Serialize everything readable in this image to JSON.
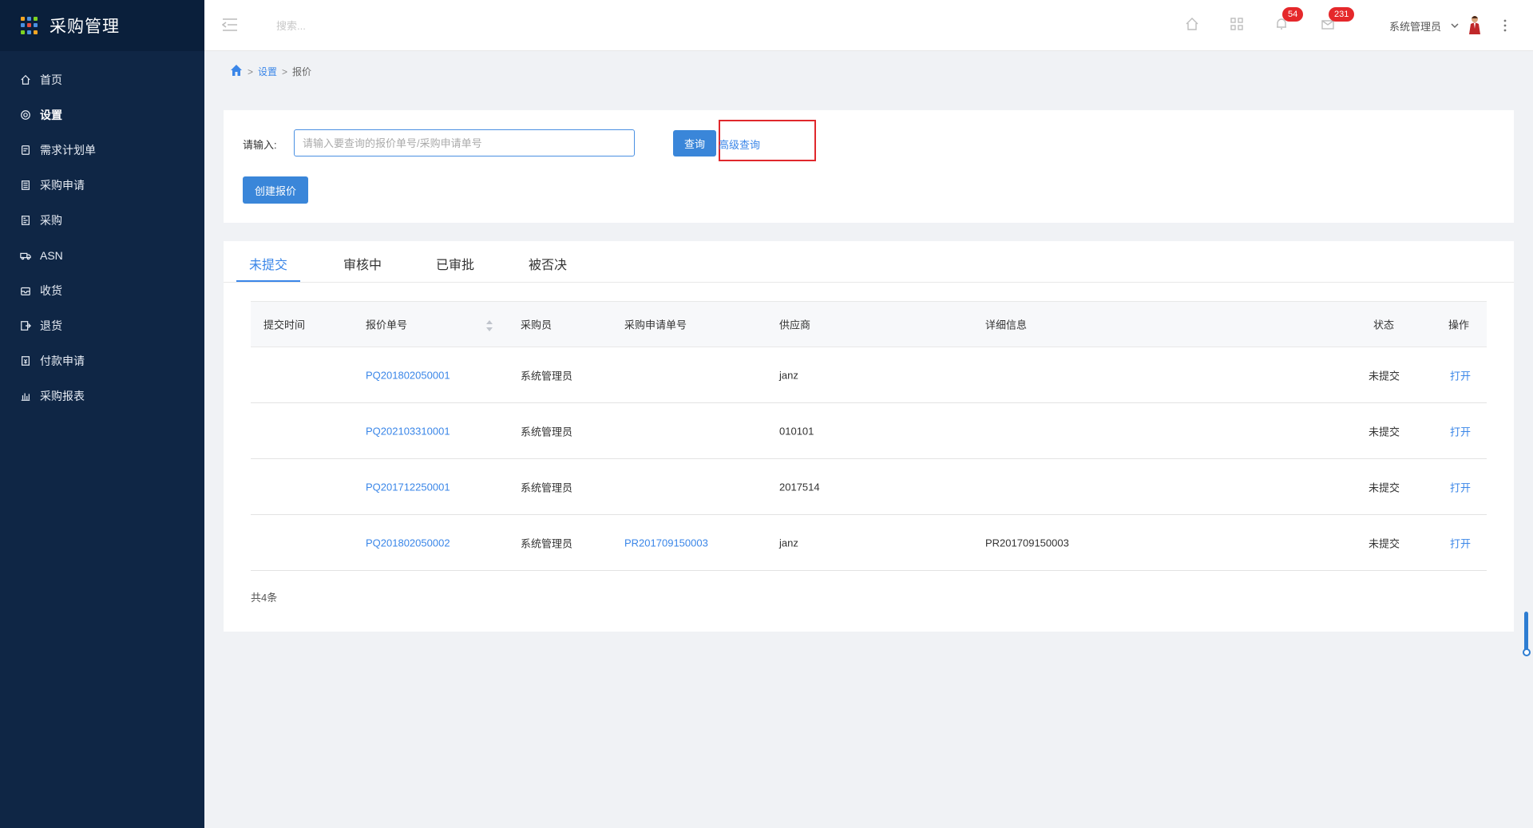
{
  "app": {
    "title": "采购管理"
  },
  "sidebar": {
    "items": [
      {
        "label": "首页",
        "icon": "home-icon"
      },
      {
        "label": "设置",
        "icon": "gear-icon"
      },
      {
        "label": "需求计划单",
        "icon": "document-icon"
      },
      {
        "label": "采购申请",
        "icon": "clipboard-icon"
      },
      {
        "label": "采购",
        "icon": "list-icon"
      },
      {
        "label": "ASN",
        "icon": "truck-icon"
      },
      {
        "label": "收货",
        "icon": "inbox-icon"
      },
      {
        "label": "退货",
        "icon": "return-icon"
      },
      {
        "label": "付款申请",
        "icon": "payment-icon"
      },
      {
        "label": "采购报表",
        "icon": "bar-chart-icon"
      }
    ],
    "active_index": 1
  },
  "header": {
    "search_placeholder": "搜索...",
    "notifications_count": "54",
    "messages_count": "231",
    "user_name": "系统管理员"
  },
  "breadcrumb": {
    "level1": "设置",
    "level2": "报价",
    "separator": ">"
  },
  "query": {
    "label": "请输入:",
    "placeholder": "请输入要查询的报价单号/采购申请单号",
    "search_button": "查询",
    "advanced_link": "高级查询",
    "create_button": "创建报价"
  },
  "tabs": [
    {
      "label": "未提交",
      "active": true
    },
    {
      "label": "审核中",
      "active": false
    },
    {
      "label": "已审批",
      "active": false
    },
    {
      "label": "被否决",
      "active": false
    }
  ],
  "table": {
    "columns": [
      "提交时间",
      "报价单号",
      "采购员",
      "采购申请单号",
      "供应商",
      "详细信息",
      "状态",
      "操作"
    ],
    "rows": [
      {
        "submit_time": "",
        "quote_no": "PQ201802050001",
        "buyer": "系统管理员",
        "pr_no": "",
        "supplier": "janz",
        "detail": "",
        "status": "未提交",
        "action": "打开"
      },
      {
        "submit_time": "",
        "quote_no": "PQ202103310001",
        "buyer": "系统管理员",
        "pr_no": "",
        "supplier": "010101",
        "detail": "",
        "status": "未提交",
        "action": "打开"
      },
      {
        "submit_time": "",
        "quote_no": "PQ201712250001",
        "buyer": "系统管理员",
        "pr_no": "",
        "supplier": "2017514",
        "detail": "",
        "status": "未提交",
        "action": "打开"
      },
      {
        "submit_time": "",
        "quote_no": "PQ201802050002",
        "buyer": "系统管理员",
        "pr_no": "PR201709150003",
        "supplier": "janz",
        "detail": "PR201709150003",
        "status": "未提交",
        "action": "打开"
      }
    ],
    "total": "共4条"
  },
  "colors": {
    "sidebar_bg": "#0f2645",
    "accent": "#3a86e8",
    "button": "#3a86d9",
    "badge": "#e5282b",
    "highlight_box": "#e0282c"
  }
}
